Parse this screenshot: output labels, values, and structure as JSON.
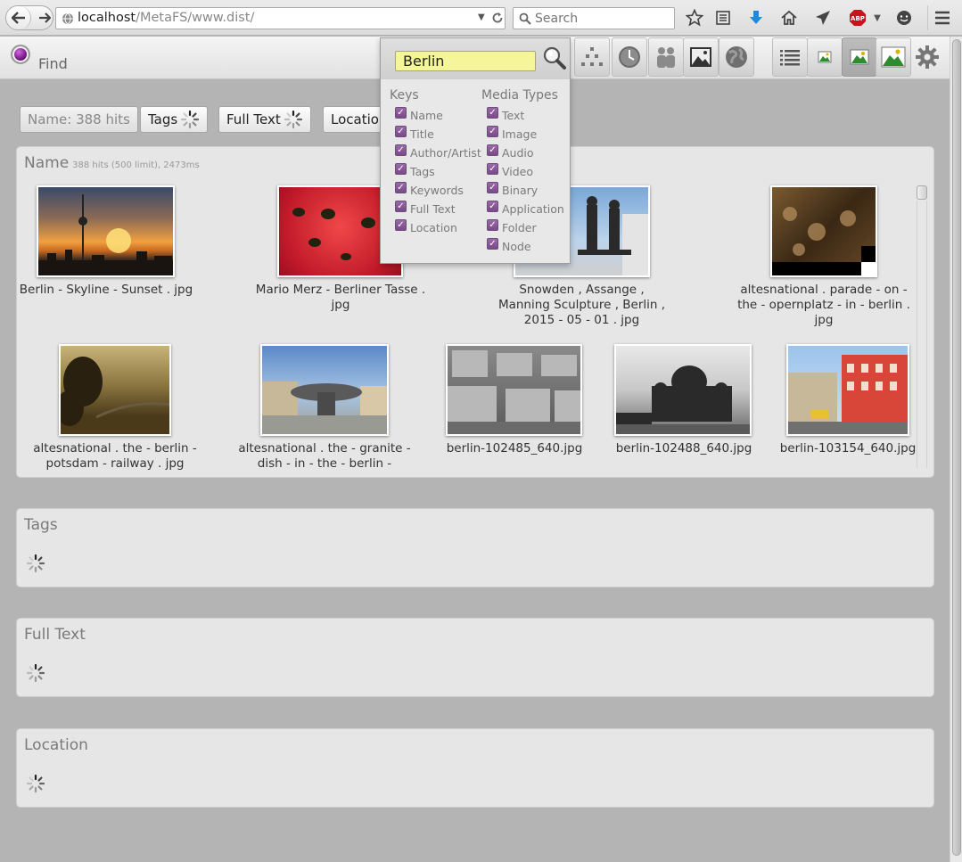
{
  "browser": {
    "url_host": "localhost",
    "url_path": "/MetaFS/www.dist/",
    "search_placeholder": "Search",
    "abp_label": "ABP"
  },
  "app": {
    "find_label": "Find",
    "search_query": "Berlin",
    "keys_heading": "Keys",
    "keys": [
      "Name",
      "Title",
      "Author/Artist",
      "Tags",
      "Keywords",
      "Full Text",
      "Location"
    ],
    "media_heading": "Media Types",
    "media_types": [
      "Text",
      "Image",
      "Audio",
      "Video",
      "Binary",
      "Application",
      "Folder",
      "Node"
    ]
  },
  "hits": {
    "name_btn": "Name: 388 hits",
    "tags_btn": "Tags",
    "fulltext_btn": "Full Text",
    "location_btn": "Location"
  },
  "panels": {
    "name_title": "Name",
    "name_meta": "388 hits (500 limit), 2473ms",
    "tags_title": "Tags",
    "fulltext_title": "Full Text",
    "location_title": "Location"
  },
  "results": [
    "Berlin - Skyline - Sunset . jpg",
    "Mario Merz - Berliner Tasse . jpg",
    "Snowden , Assange , Manning Sculpture , Berlin , 2015 - 05 - 01 . jpg",
    "altesnational . parade - on - the - opernplatz - in - berlin . jpg",
    "altesnational . the - berlin - potsdam - railway . jpg",
    "altesnational . the - granite - dish - in - the - berlin -",
    "berlin-102485_640.jpg",
    "berlin-102488_640.jpg",
    "berlin-103154_640.jpg"
  ],
  "colors": {
    "accent_purple": "#7a4a88",
    "search_highlight": "#f5f59a"
  }
}
